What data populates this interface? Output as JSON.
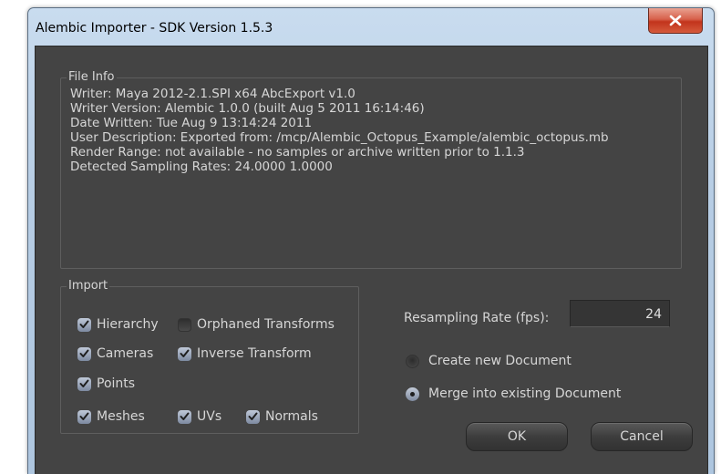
{
  "window": {
    "title": "Alembic Importer - SDK Version 1.5.3",
    "close_icon": "close-icon"
  },
  "file_info": {
    "title": "File Info",
    "lines": [
      "Writer: Maya 2012-2.1.SPI x64 AbcExport v1.0",
      "Writer Version: Alembic 1.0.0 (built Aug  5 2011 16:14:46)",
      "Date Written: Tue Aug  9 13:14:24 2011",
      "User Description: Exported from: /mcp/Alembic_Octopus_Example/alembic_octopus.mb",
      "Render Range: not available - no samples or archive written prior to 1.1.3",
      "Detected Sampling Rates: 24.0000 1.0000"
    ]
  },
  "import": {
    "title": "Import",
    "options": [
      {
        "label": "Hierarchy",
        "checked": true
      },
      {
        "label": "Orphaned Transforms",
        "checked": false
      },
      {
        "label": "Cameras",
        "checked": true
      },
      {
        "label": "Inverse Transform",
        "checked": true
      },
      {
        "label": "Points",
        "checked": true
      },
      {
        "label": "Meshes",
        "checked": true
      },
      {
        "label": "UVs",
        "checked": true
      },
      {
        "label": "Normals",
        "checked": true
      }
    ]
  },
  "resampling": {
    "label": "Resampling Rate (fps):",
    "value": "24"
  },
  "document_mode": {
    "options": [
      {
        "label": "Create new Document",
        "selected": false
      },
      {
        "label": "Merge into existing Document",
        "selected": true
      }
    ]
  },
  "buttons": {
    "ok": "OK",
    "cancel": "Cancel"
  },
  "colors": {
    "panel_bg": "#444444",
    "text": "#d6d6d6",
    "close_button": "#c7442d",
    "frame": "#bcd2e8"
  }
}
